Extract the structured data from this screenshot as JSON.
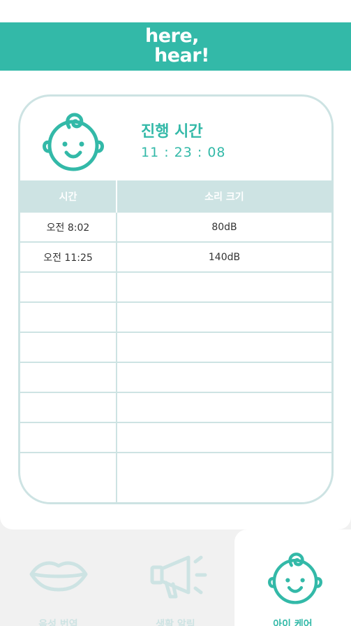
{
  "app": {
    "logo_line1": "here,",
    "logo_line2": "hear!"
  },
  "progress": {
    "title": "진행 시간",
    "time": "11 : 23 : 08"
  },
  "table": {
    "headers": [
      "시간",
      "소리 크기"
    ],
    "rows": [
      [
        "오전 8:02",
        "80dB"
      ],
      [
        "오전 11:25",
        "140dB"
      ],
      [
        "",
        ""
      ],
      [
        "",
        ""
      ],
      [
        "",
        ""
      ],
      [
        "",
        ""
      ],
      [
        "",
        ""
      ],
      [
        "",
        ""
      ],
      [
        "",
        ""
      ]
    ]
  },
  "nav": {
    "items": [
      {
        "label": "음성 번역",
        "icon": "lips-icon",
        "active": false
      },
      {
        "label": "생활 알림",
        "icon": "megaphone-icon",
        "active": false
      },
      {
        "label": "아이 케어",
        "icon": "baby-face-icon",
        "active": true
      }
    ]
  },
  "colors": {
    "brand": "#33b9a8",
    "light": "#cde3e3",
    "inactive": "#cde3e3"
  }
}
